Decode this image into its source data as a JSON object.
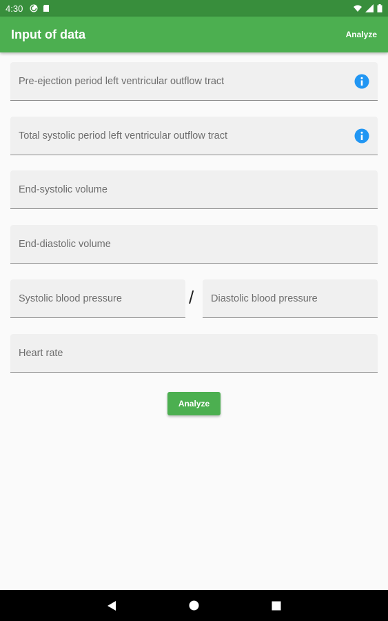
{
  "status_bar": {
    "time": "4:30",
    "icons": [
      "sync-icon",
      "sd-card-icon",
      "wifi-icon",
      "signal-icon",
      "battery-icon"
    ]
  },
  "app_bar": {
    "title": "Input of data",
    "action_label": "Analyze",
    "color": "#4caf50"
  },
  "form": {
    "fields": [
      {
        "label": "Pre-ejection period left ventricular outflow tract",
        "info_icon": true
      },
      {
        "label": "Total systolic period left ventricular outflow tract",
        "info_icon": true
      },
      {
        "label": "End-systolic volume",
        "info_icon": false
      },
      {
        "label": "End-diastolic volume",
        "info_icon": false
      },
      {
        "label": "Heart rate",
        "info_icon": false
      }
    ],
    "systolic_label": "Systolic blood pressure",
    "separator": "/",
    "diastolic_label": "Diastolic blood pressure",
    "analyze_button": "Analyze",
    "info_color": "#2196f3"
  },
  "nav_bar": {
    "buttons": [
      "back-icon",
      "home-icon",
      "recents-icon"
    ]
  }
}
